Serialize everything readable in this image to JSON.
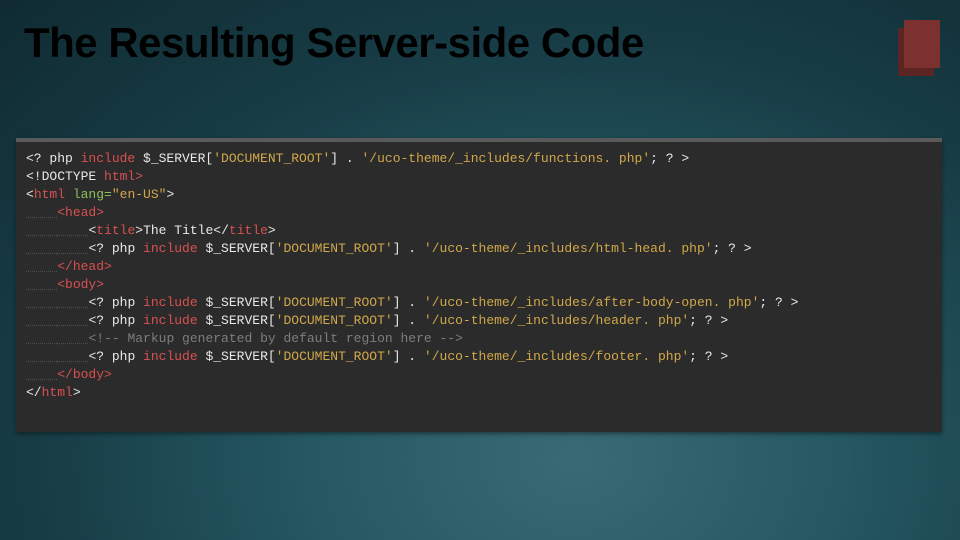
{
  "slide": {
    "title": "The Resulting Server-side Code"
  },
  "code": {
    "tab": "    ",
    "l1_a": "<? php ",
    "l1_b": "include",
    "l1_c": " $_SERVER[",
    "l1_d": "'DOCUMENT_ROOT'",
    "l1_e": "] . ",
    "l1_f": "'/uco-theme/_includes/functions. php'",
    "l1_g": "; ? >",
    "l2_a": "<!DOCTYPE ",
    "l2_b": "html>",
    "l3_a": "<",
    "l3_b": "html ",
    "l3_c": "lang=",
    "l3_d": "\"en-US\"",
    "l3_e": ">",
    "l4_a": "<head>",
    "l5_a": "<",
    "l5_b": "title",
    "l5_c": ">The Title</",
    "l5_d": "title",
    "l5_e": ">",
    "l6_a": "<? php ",
    "l6_b": "include",
    "l6_c": " $_SERVER[",
    "l6_d": "'DOCUMENT_ROOT'",
    "l6_e": "] . ",
    "l6_f": "'/uco-theme/_includes/html-head. php'",
    "l6_g": "; ? >",
    "l7_a": "</head>",
    "l8_a": "<body>",
    "l9_a": "<? php ",
    "l9_b": "include",
    "l9_c": " $_SERVER[",
    "l9_d": "'DOCUMENT_ROOT'",
    "l9_e": "] . ",
    "l9_f": "'/uco-theme/_includes/after-body-open. php'",
    "l9_g": "; ? >",
    "l10_a": "<? php ",
    "l10_b": "include",
    "l10_c": " $_SERVER[",
    "l10_d": "'DOCUMENT_ROOT'",
    "l10_e": "] . ",
    "l10_f": "'/uco-theme/_includes/header. php'",
    "l10_g": "; ? >",
    "l11_a": "<!-- Markup generated by default region here -->",
    "l12_a": "<? php ",
    "l12_b": "include",
    "l12_c": " $_SERVER[",
    "l12_d": "'DOCUMENT_ROOT'",
    "l12_e": "] . ",
    "l12_f": "'/uco-theme/_includes/footer. php'",
    "l12_g": "; ? >",
    "l13_a": "</body>",
    "l14_a": "</",
    "l14_b": "html",
    "l14_c": ">"
  }
}
